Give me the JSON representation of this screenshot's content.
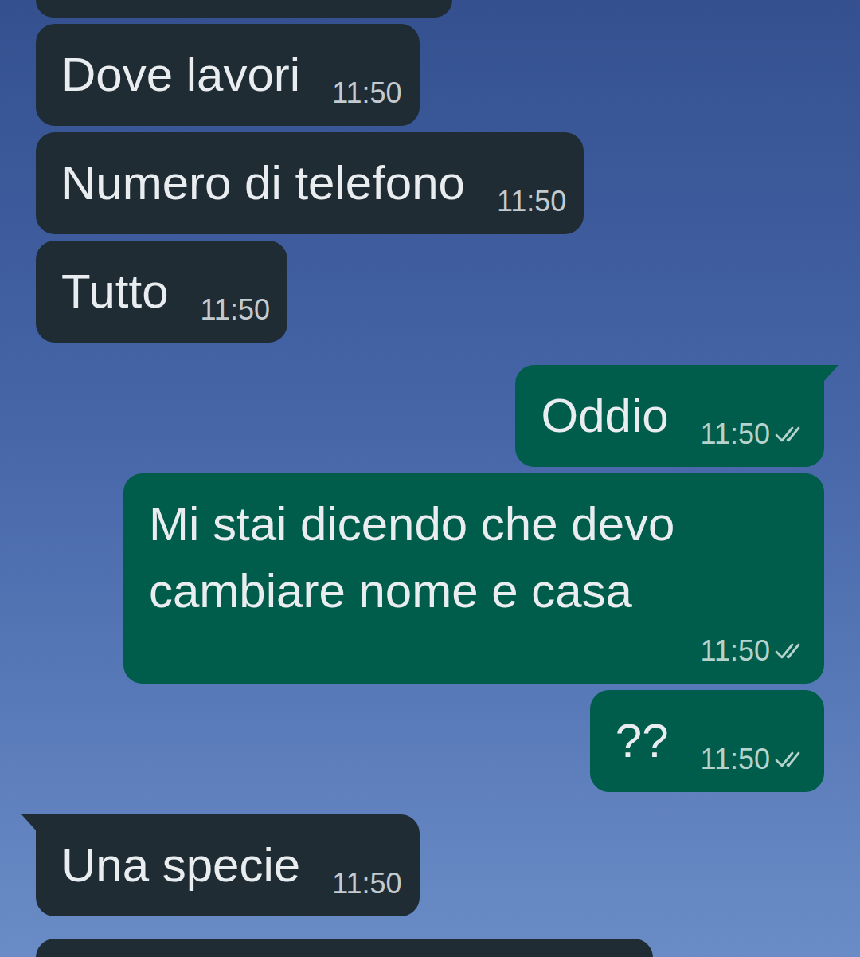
{
  "chat": {
    "messages": [
      {
        "direction": "in",
        "text": "Dove lavori",
        "time": "11:50",
        "delivered": false
      },
      {
        "direction": "in",
        "text": "Numero di telefono",
        "time": "11:50",
        "delivered": false
      },
      {
        "direction": "in",
        "text": "Tutto",
        "time": "11:50",
        "delivered": false
      },
      {
        "direction": "out",
        "text": "Oddio",
        "time": "11:50",
        "delivered": true
      },
      {
        "direction": "out",
        "text": "Mi stai dicendo che devo cambiare nome e casa",
        "time": "11:50",
        "delivered": true
      },
      {
        "direction": "out",
        "text": "??",
        "time": "11:50",
        "delivered": true
      },
      {
        "direction": "in",
        "text": "Una specie",
        "time": "11:50",
        "delivered": false
      }
    ]
  }
}
